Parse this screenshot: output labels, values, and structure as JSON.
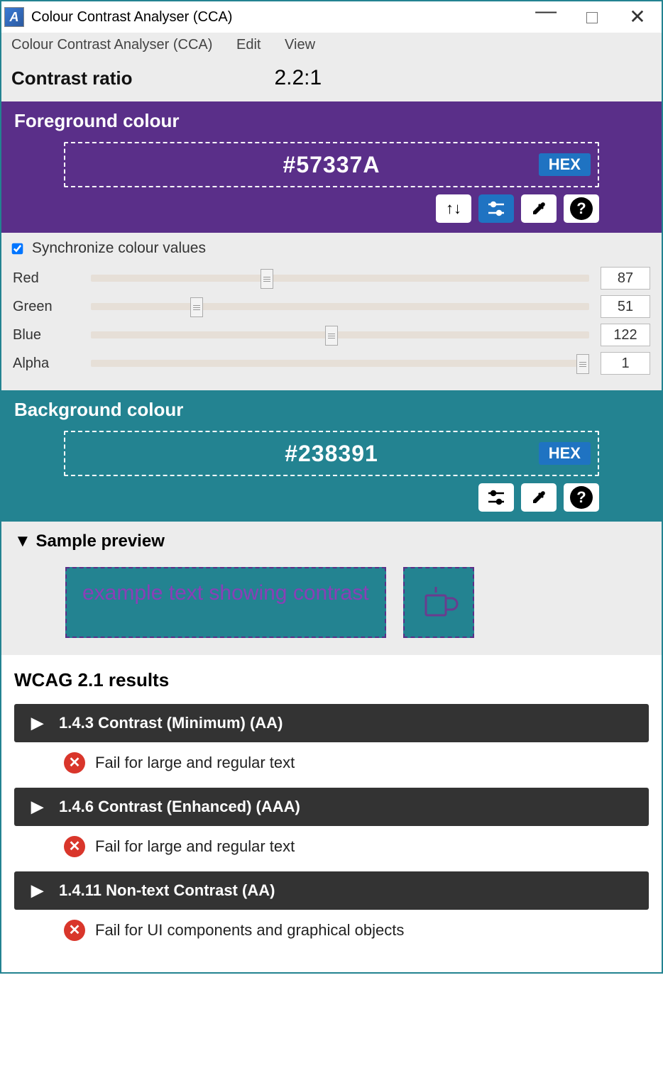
{
  "titlebar": {
    "title": "Colour Contrast Analyser (CCA)"
  },
  "menu": {
    "app": "Colour Contrast Analyser (CCA)",
    "edit": "Edit",
    "view": "View"
  },
  "ratio": {
    "label": "Contrast ratio",
    "value": "2.2:1"
  },
  "foreground": {
    "heading": "Foreground colour",
    "hex": "#57337A",
    "tag": "HEX",
    "color": "#5a2f89"
  },
  "background": {
    "heading": "Background colour",
    "hex": "#238391",
    "tag": "HEX",
    "color": "#238391"
  },
  "sliders": {
    "sync_label": "Synchronize colour values",
    "sync_checked": true,
    "channels": [
      {
        "label": "Red",
        "value": 87,
        "max": 255
      },
      {
        "label": "Green",
        "value": 51,
        "max": 255
      },
      {
        "label": "Blue",
        "value": 122,
        "max": 255
      },
      {
        "label": "Alpha",
        "value": 1,
        "max": 1
      }
    ]
  },
  "preview": {
    "heading": "Sample preview",
    "text": "example text showing contrast"
  },
  "results": {
    "heading": "WCAG 2.1 results",
    "items": [
      {
        "title": "1.4.3 Contrast (Minimum) (AA)",
        "detail": "Fail for large and regular text"
      },
      {
        "title": "1.4.6 Contrast (Enhanced) (AAA)",
        "detail": "Fail for large and regular text"
      },
      {
        "title": "1.4.11 Non-text Contrast (AA)",
        "detail": "Fail for UI components and graphical objects"
      }
    ]
  }
}
